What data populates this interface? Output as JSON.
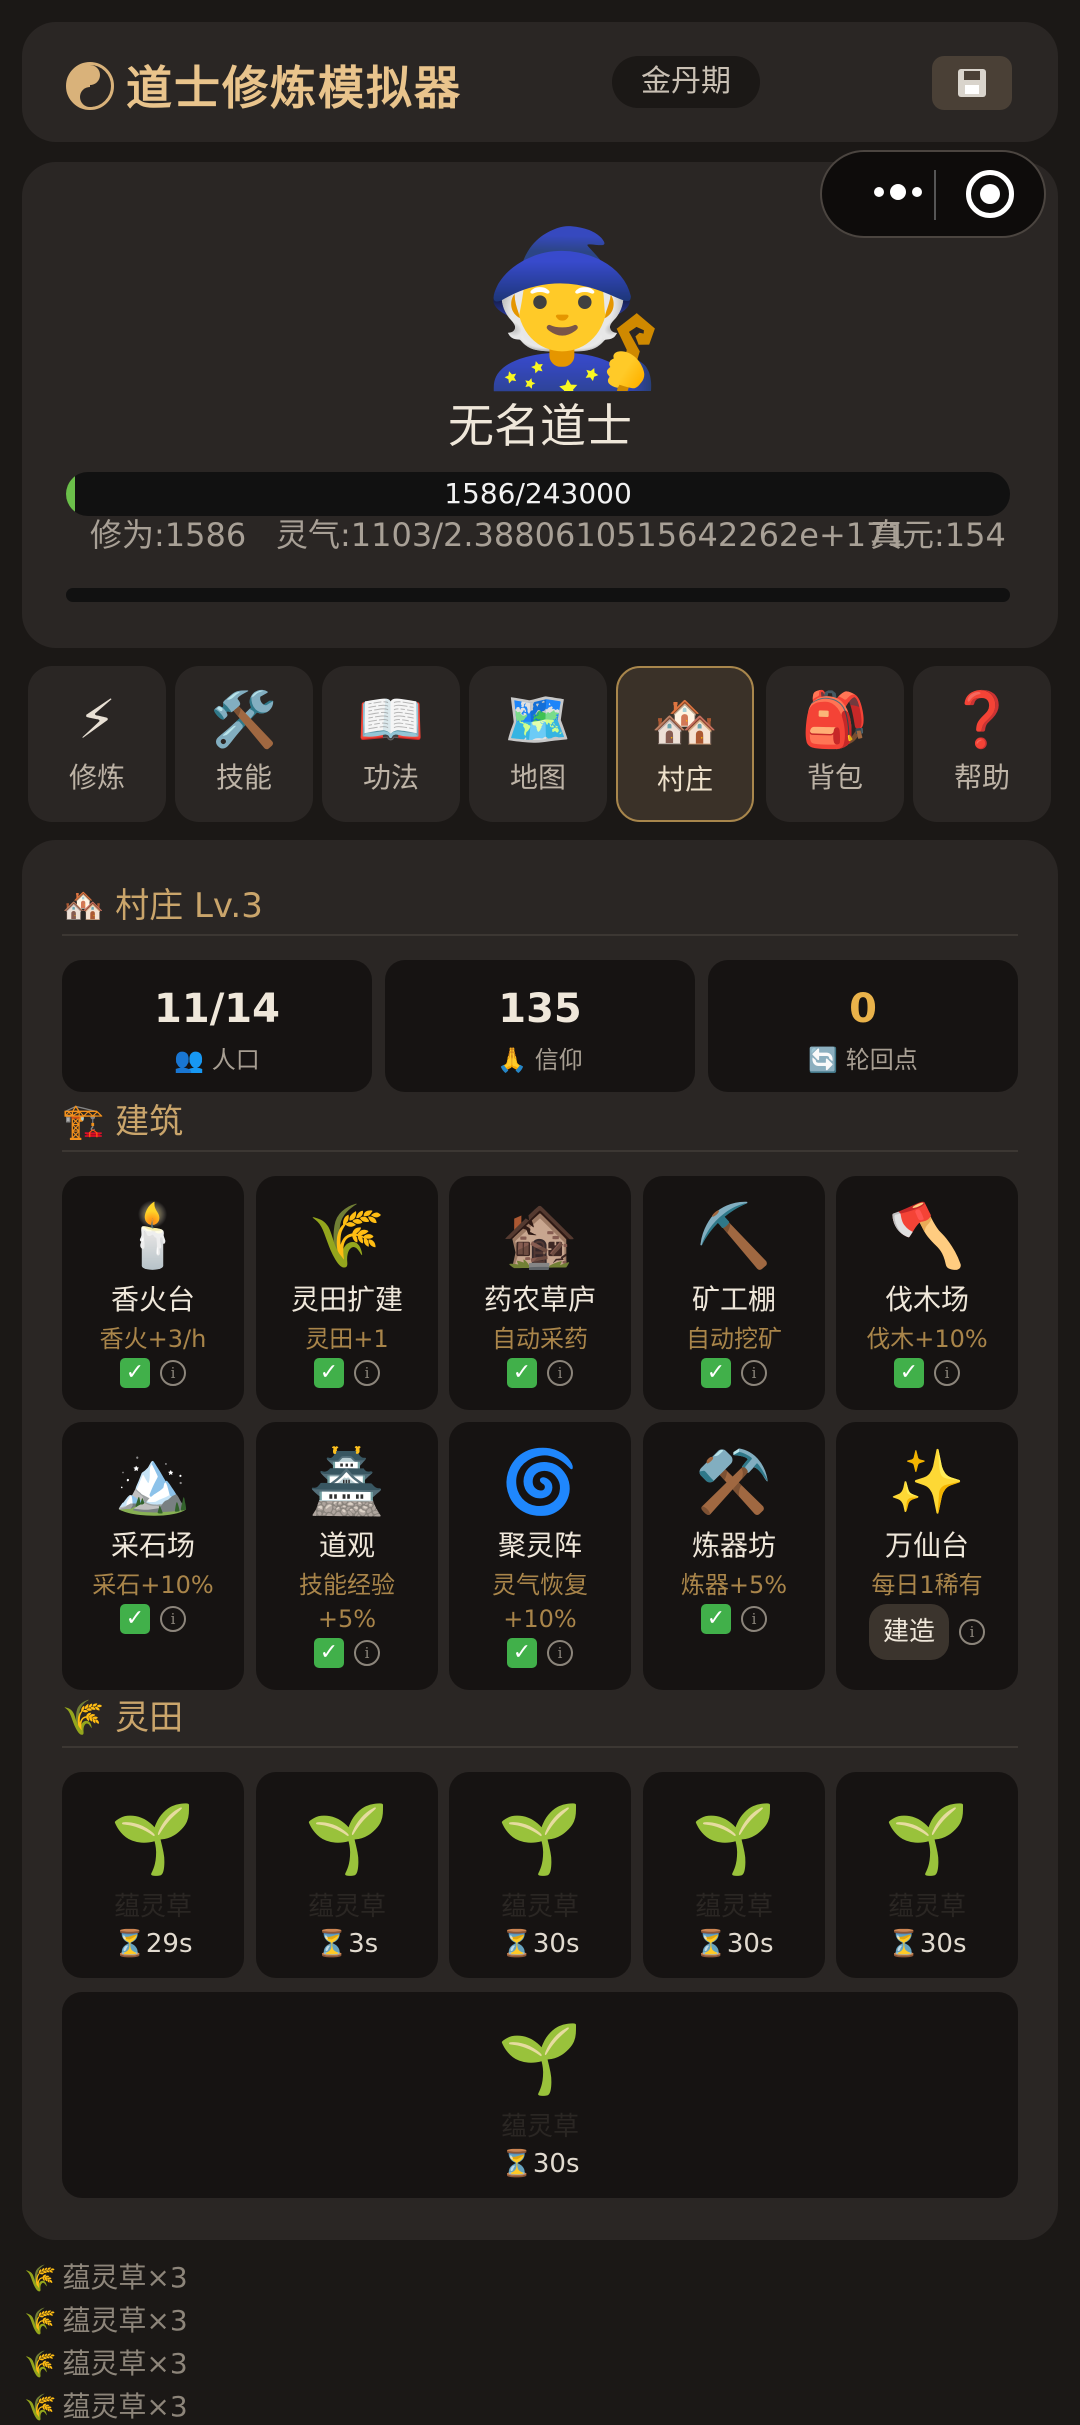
{
  "header": {
    "title": "道士修炼模拟器",
    "realm": "金丹期",
    "save_icon": "floppy-disk-icon"
  },
  "profile": {
    "name": "无名道士",
    "avatar": "🧙",
    "xp_text": "1586/243000",
    "xp_fraction": 0.0065,
    "cultivation": "修为:1586",
    "spirit": "灵气:1103/2.3880610515642262e+171",
    "true_essence": "真元:154"
  },
  "tabs": [
    {
      "icon": "⚡",
      "label": "修炼"
    },
    {
      "icon": "🛠️",
      "label": "技能"
    },
    {
      "icon": "📖",
      "label": "功法"
    },
    {
      "icon": "🗺️",
      "label": "地图"
    },
    {
      "icon": "🏘️",
      "label": "村庄"
    },
    {
      "icon": "🎒",
      "label": "背包"
    },
    {
      "icon": "❓",
      "label": "帮助"
    }
  ],
  "active_tab": "村庄",
  "village": {
    "title": "村庄 Lv.3",
    "title_icon": "🏘️",
    "stats": [
      {
        "value": "11/14",
        "icon": "👥",
        "label": "人口"
      },
      {
        "value": "135",
        "icon": "🙏",
        "label": "信仰"
      },
      {
        "value": "0",
        "icon": "🔄",
        "label": "轮回点"
      }
    ],
    "buildings_title": "建筑",
    "buildings_icon": "🏗️",
    "buildings": [
      {
        "icon": "🕯️",
        "name": "香火台",
        "effect": "香火+3/h",
        "built": true
      },
      {
        "icon": "🌾",
        "name": "灵田扩建",
        "effect": "灵田+1",
        "built": true
      },
      {
        "icon": "🏚️",
        "name": "药农草庐",
        "effect": "自动采药",
        "built": true
      },
      {
        "icon": "⛏️",
        "name": "矿工棚",
        "effect": "自动挖矿",
        "built": true
      },
      {
        "icon": "🪓",
        "name": "伐木场",
        "effect": "伐木+10%",
        "built": true
      },
      {
        "icon": "🏔️",
        "name": "采石场",
        "effect": "采石+10%",
        "built": true
      },
      {
        "icon": "🏯",
        "name": "道观",
        "effect": "技能经验",
        "effect2": "+5%",
        "built": true
      },
      {
        "icon": "🌀",
        "name": "聚灵阵",
        "effect": "灵气恢复",
        "effect2": "+10%",
        "built": true
      },
      {
        "icon": "⚒️",
        "name": "炼器坊",
        "effect": "炼器+5%",
        "built": true
      },
      {
        "icon": "✨",
        "name": "万仙台",
        "effect": "每日1稀有",
        "built": false,
        "build_label": "建造"
      }
    ],
    "fields_title": "灵田",
    "fields_icon": "🌾",
    "fields": [
      {
        "icon": "🌱",
        "herb": "蕴灵草",
        "timer": "⏳29s"
      },
      {
        "icon": "🌱",
        "herb": "蕴灵草",
        "timer": "⏳3s"
      },
      {
        "icon": "🌱",
        "herb": "蕴灵草",
        "timer": "⏳30s"
      },
      {
        "icon": "🌱",
        "herb": "蕴灵草",
        "timer": "⏳30s"
      },
      {
        "icon": "🌱",
        "herb": "蕴灵草",
        "timer": "⏳30s"
      },
      {
        "icon": "🌱",
        "herb": "蕴灵草",
        "timer": "⏳30s"
      }
    ]
  },
  "log": [
    {
      "icon": "🌾",
      "text": "蕴灵草×3"
    },
    {
      "icon": "🌾",
      "text": "蕴灵草×3"
    },
    {
      "icon": "🌾",
      "text": "蕴灵草×3"
    },
    {
      "icon": "🌾",
      "text": "蕴灵草×3"
    }
  ],
  "colors": {
    "accent": "#caa56b",
    "xp_fill": "#6bbf4a",
    "check": "#41b04a"
  }
}
